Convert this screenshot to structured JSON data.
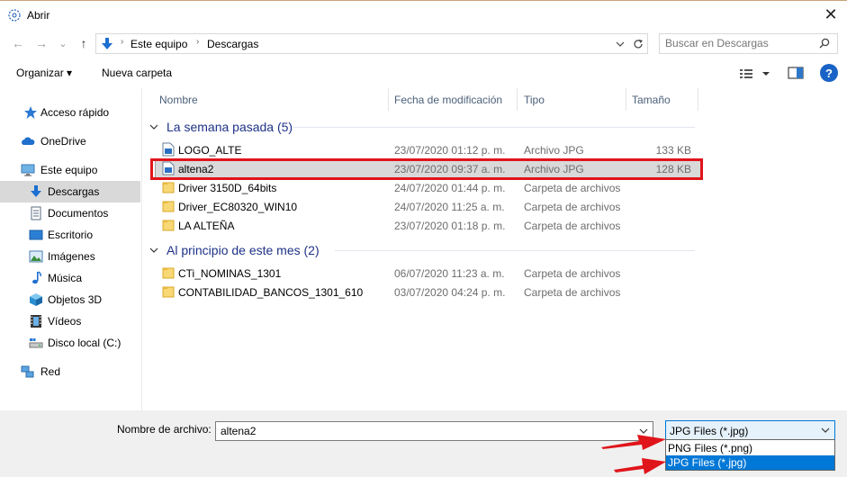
{
  "window": {
    "title": "Abrir",
    "close_glyph": "✕"
  },
  "address": {
    "back_glyph": "←",
    "forward_glyph": "→",
    "recent_glyph": "⌄",
    "up_glyph": "↑",
    "crumbs": [
      "Este equipo",
      "Descargas"
    ],
    "separator": "›",
    "search_placeholder": "Buscar en Descargas"
  },
  "toolbar": {
    "organize_label": "Organizar ▾",
    "new_folder_label": "Nueva carpeta",
    "help_label": "?"
  },
  "sidebar": {
    "items": [
      {
        "label": "Acceso rápido",
        "icon": "star-icon"
      },
      {
        "label": "OneDrive",
        "icon": "cloud-icon"
      },
      {
        "label": "Este equipo",
        "icon": "computer-icon"
      },
      {
        "label": "Descargas",
        "icon": "download-icon",
        "selected": true
      },
      {
        "label": "Documentos",
        "icon": "document-icon"
      },
      {
        "label": "Escritorio",
        "icon": "desktop-icon"
      },
      {
        "label": "Imágenes",
        "icon": "images-icon"
      },
      {
        "label": "Música",
        "icon": "music-icon"
      },
      {
        "label": "Objetos 3D",
        "icon": "cube-icon"
      },
      {
        "label": "Vídeos",
        "icon": "video-icon"
      },
      {
        "label": "Disco local (C:)",
        "icon": "drive-icon"
      },
      {
        "label": "Red",
        "icon": "network-icon"
      }
    ]
  },
  "columns": {
    "name": "Nombre",
    "date": "Fecha de modificación",
    "type": "Tipo",
    "size": "Tamaño"
  },
  "groups": [
    {
      "title": "La semana pasada (5)",
      "rows": [
        {
          "name": "LOGO_ALTE",
          "date": "23/07/2020 01:12 p. m.",
          "type": "Archivo JPG",
          "size": "133 KB",
          "kind": "image"
        },
        {
          "name": "altena2",
          "date": "23/07/2020 09:37 a. m.",
          "type": "Archivo JPG",
          "size": "128 KB",
          "kind": "image",
          "selected": true
        },
        {
          "name": "Driver 3150D_64bits",
          "date": "24/07/2020 01:44 p. m.",
          "type": "Carpeta de archivos",
          "size": "",
          "kind": "folder"
        },
        {
          "name": "Driver_EC80320_WIN10",
          "date": "24/07/2020 11:25 a. m.",
          "type": "Carpeta de archivos",
          "size": "",
          "kind": "folder"
        },
        {
          "name": "LA ALTEÑA",
          "date": "23/07/2020 01:18 p. m.",
          "type": "Carpeta de archivos",
          "size": "",
          "kind": "folder"
        }
      ]
    },
    {
      "title": "Al principio de este mes (2)",
      "rows": [
        {
          "name": "CTi_NOMINAS_1301",
          "date": "06/07/2020 11:23 a. m.",
          "type": "Carpeta de archivos",
          "size": "",
          "kind": "folder"
        },
        {
          "name": "CONTABILIDAD_BANCOS_1301_610",
          "date": "03/07/2020 04:24 p. m.",
          "type": "Carpeta de archivos",
          "size": "",
          "kind": "folder"
        }
      ]
    }
  ],
  "footer": {
    "filename_label": "Nombre de archivo:",
    "filename_value": "altena2",
    "filetype_value": "JPG Files (*.jpg)",
    "filetype_options": [
      "PNG Files (*.png)",
      "JPG Files (*.jpg)"
    ],
    "dropdown_glyph": "⌄"
  },
  "colors": {
    "highlight": "#e0151b",
    "selection_blue": "#0078d7",
    "group_title": "#1e3287"
  }
}
